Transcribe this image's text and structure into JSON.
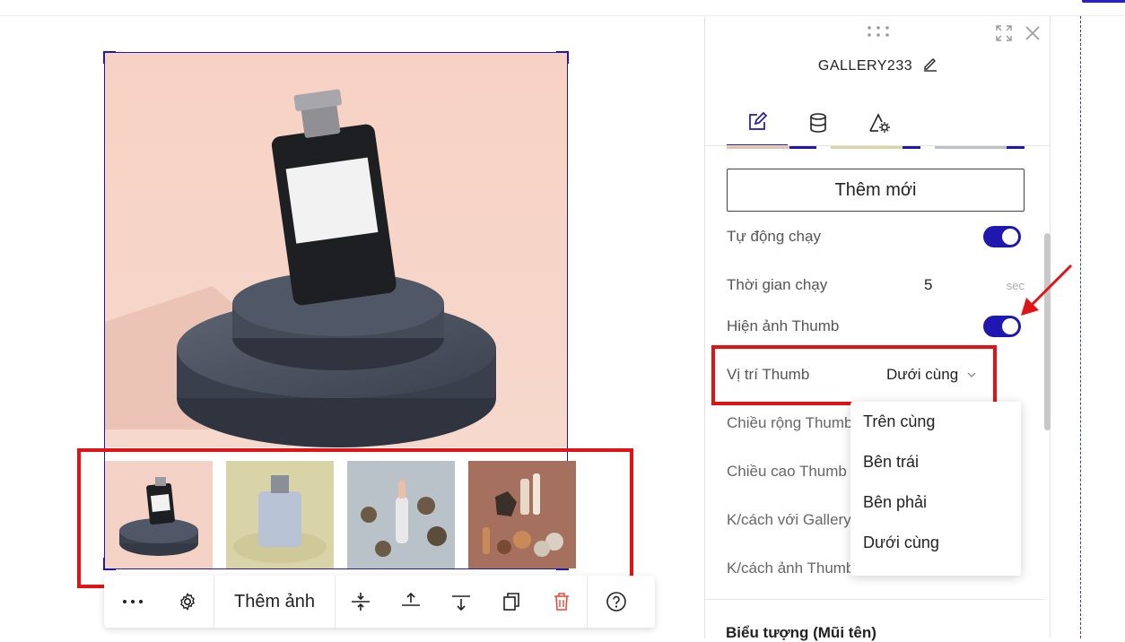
{
  "panel": {
    "title": "GALLERY233",
    "add_new_label": "Thêm mới",
    "rows": {
      "autoplay": {
        "label": "Tự động chạy",
        "enabled": true
      },
      "duration": {
        "label": "Thời gian chạy",
        "value": "5",
        "unit": "sec"
      },
      "show_thumb": {
        "label": "Hiện ảnh Thumb",
        "enabled": true
      },
      "thumb_position": {
        "label": "Vị trí Thumb",
        "value": "Dưới cùng"
      },
      "thumb_width": {
        "label": "Chiều rộng Thumb"
      },
      "thumb_height": {
        "label": "Chiều cao Thumb"
      },
      "gallery_spacing": {
        "label": "K/cách với Gallery"
      },
      "thumb_spacing": {
        "label": "K/cách ảnh Thumb"
      }
    },
    "dropdown_options": [
      "Trên cùng",
      "Bên trái",
      "Bên phải",
      "Dưới cùng"
    ],
    "next_section": "Biểu tượng (Mũi tên)"
  },
  "toolbar": {
    "add_image_label": "Thêm ảnh"
  },
  "colors": {
    "accent": "#1f17b0",
    "highlight": "#e01414"
  }
}
